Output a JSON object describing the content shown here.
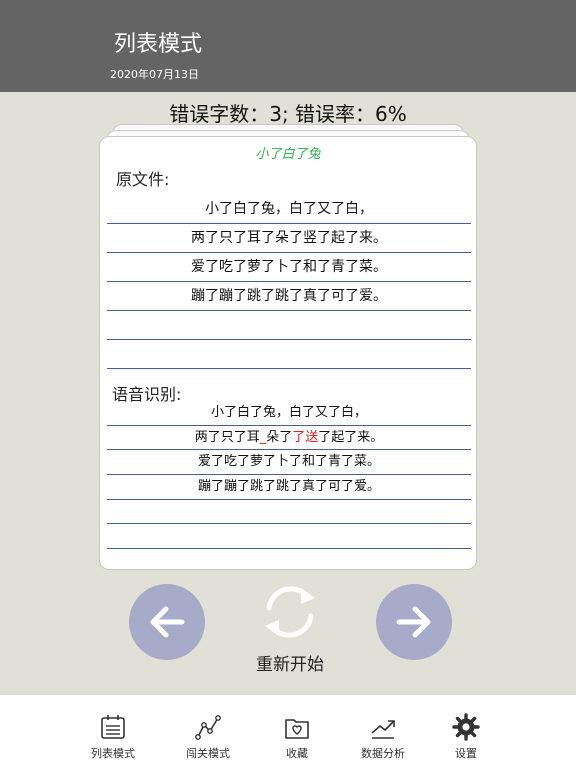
{
  "header": {
    "title": "列表模式",
    "date": "2020年07月13日"
  },
  "stats": {
    "text": "错误字数：3; 错误率：6%"
  },
  "card": {
    "title": "小了白了兔",
    "original_label": "原文件:",
    "original_lines": [
      "小了白了兔，白了又了白，",
      "两了只了耳了朵了竖了起了来。",
      "爱了吃了萝了卜了和了青了菜。",
      "蹦了蹦了跳了跳了真了可了爱。",
      "",
      ""
    ],
    "recognition_label": "语音识别:",
    "recognition_lines": [
      {
        "before": "小了白了兔，白了又了白，",
        "error": "",
        "after": ""
      },
      {
        "before": "两了只了耳",
        "error": "_",
        "after": "朵了"
      },
      {
        "before": "爱了吃了萝了卜了和了青了菜。",
        "error": "",
        "after": ""
      },
      {
        "before": "蹦了蹦了跳了跳了真了可了爱。",
        "error": "",
        "after": ""
      },
      {
        "before": "",
        "error": "",
        "after": ""
      },
      {
        "before": "",
        "error": "",
        "after": ""
      }
    ],
    "recognition_line2_error2": "了送",
    "recognition_line2_after2": "了起了来。"
  },
  "controls": {
    "prev_icon": "arrow-left-icon",
    "next_icon": "arrow-right-icon",
    "restart_icon": "refresh-icon",
    "restart_label": "重新开始",
    "button_color": "#a7aac8"
  },
  "tabbar": {
    "items": [
      {
        "label": "列表模式",
        "icon": "calendar-list-icon"
      },
      {
        "label": "闯关模式",
        "icon": "route-icon"
      },
      {
        "label": "收藏",
        "icon": "heart-folder-icon"
      },
      {
        "label": "数据分析",
        "icon": "trend-chart-icon"
      },
      {
        "label": "设置",
        "icon": "gear-icon"
      }
    ]
  },
  "colors": {
    "header_bg": "#646464",
    "page_bg": "#e0e0d6",
    "title_green": "#2db34a",
    "error_red": "#e0201a",
    "rule_line": "#4a5a9a"
  }
}
